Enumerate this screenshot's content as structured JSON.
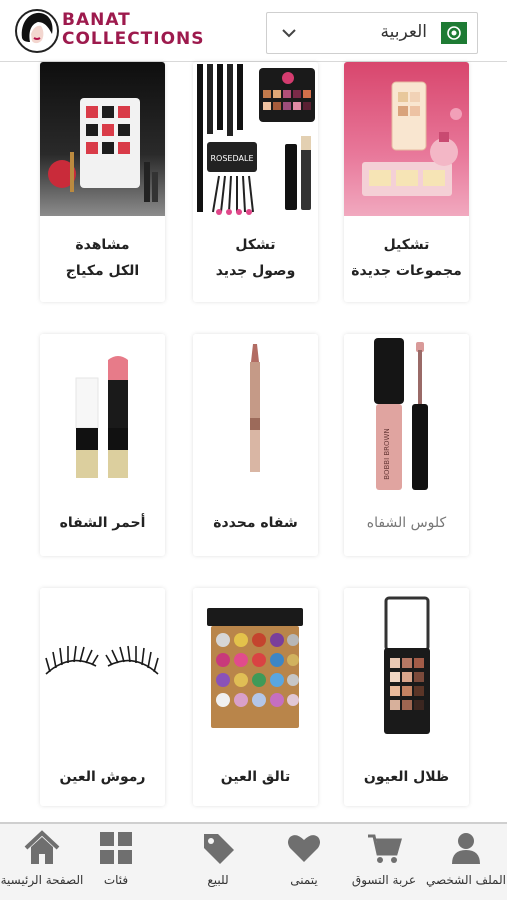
{
  "brand": {
    "line1": "BANAT",
    "line2": "COLLECTIONS",
    "color": "#9d1a4d"
  },
  "language_selector": {
    "selected": "العربية",
    "flag_icon": "saudi-flag-icon",
    "chevron_icon": "chevron-down-icon"
  },
  "categories": [
    {
      "line1": "تشكيل",
      "line2": "مجموعات جديدة"
    },
    {
      "line1": "تشكل",
      "line2": "وصول جديد"
    },
    {
      "line1": "مشاهدة",
      "line2": "الكل مكياج"
    },
    {
      "line1": "كلوس الشفاه",
      "line2": ""
    },
    {
      "line1": "شفاه محددة",
      "line2": ""
    },
    {
      "line1": "أحمر الشفاه",
      "line2": ""
    },
    {
      "line1": "ظلال العيون",
      "line2": ""
    },
    {
      "line1": "تالق العين",
      "line2": ""
    },
    {
      "line1": "رموش العين",
      "line2": ""
    }
  ],
  "product_images": {
    "palette_brand": "ROSEDALE",
    "lipgloss_brand": "BOBBI BROWN"
  },
  "bottom_nav": [
    {
      "label": "الملف الشخصي",
      "icon": "user-icon"
    },
    {
      "label": "عربة التسوق",
      "icon": "cart-icon"
    },
    {
      "label": "يتمنى",
      "icon": "heart-icon"
    },
    {
      "label": "للبيع",
      "icon": "tag-icon"
    },
    {
      "label": "فئات",
      "icon": "grid-icon"
    },
    {
      "label": "الصفحة الرئيسية",
      "icon": "home-icon"
    }
  ],
  "colors": {
    "nav_icon": "#6f6f6f",
    "accent": "#9d1a4d"
  }
}
